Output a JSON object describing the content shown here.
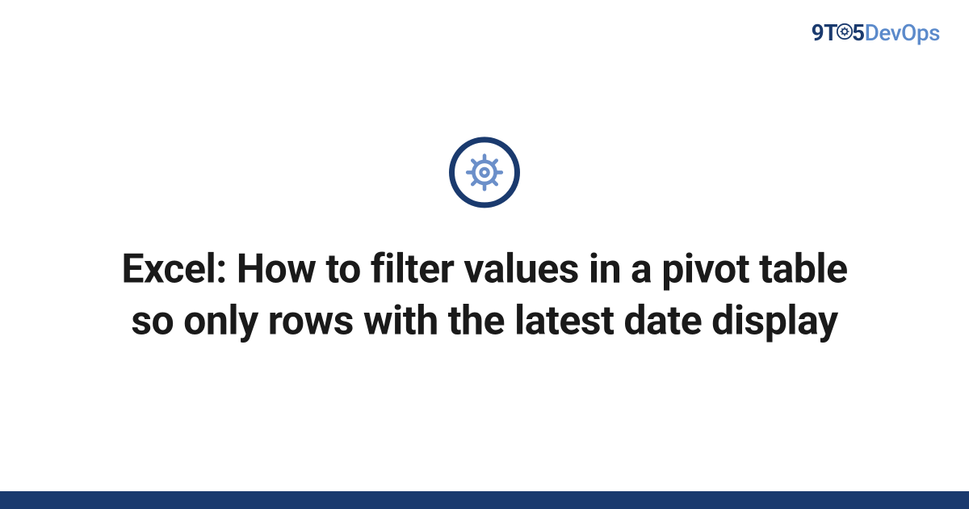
{
  "logo": {
    "prefix": "9T",
    "suffix": "5",
    "brand": "DevOps"
  },
  "main": {
    "title": "Excel: How to filter values in a pivot table so only rows with the latest date display"
  },
  "colors": {
    "primary": "#1a3a6e",
    "accent": "#5b8acb"
  }
}
